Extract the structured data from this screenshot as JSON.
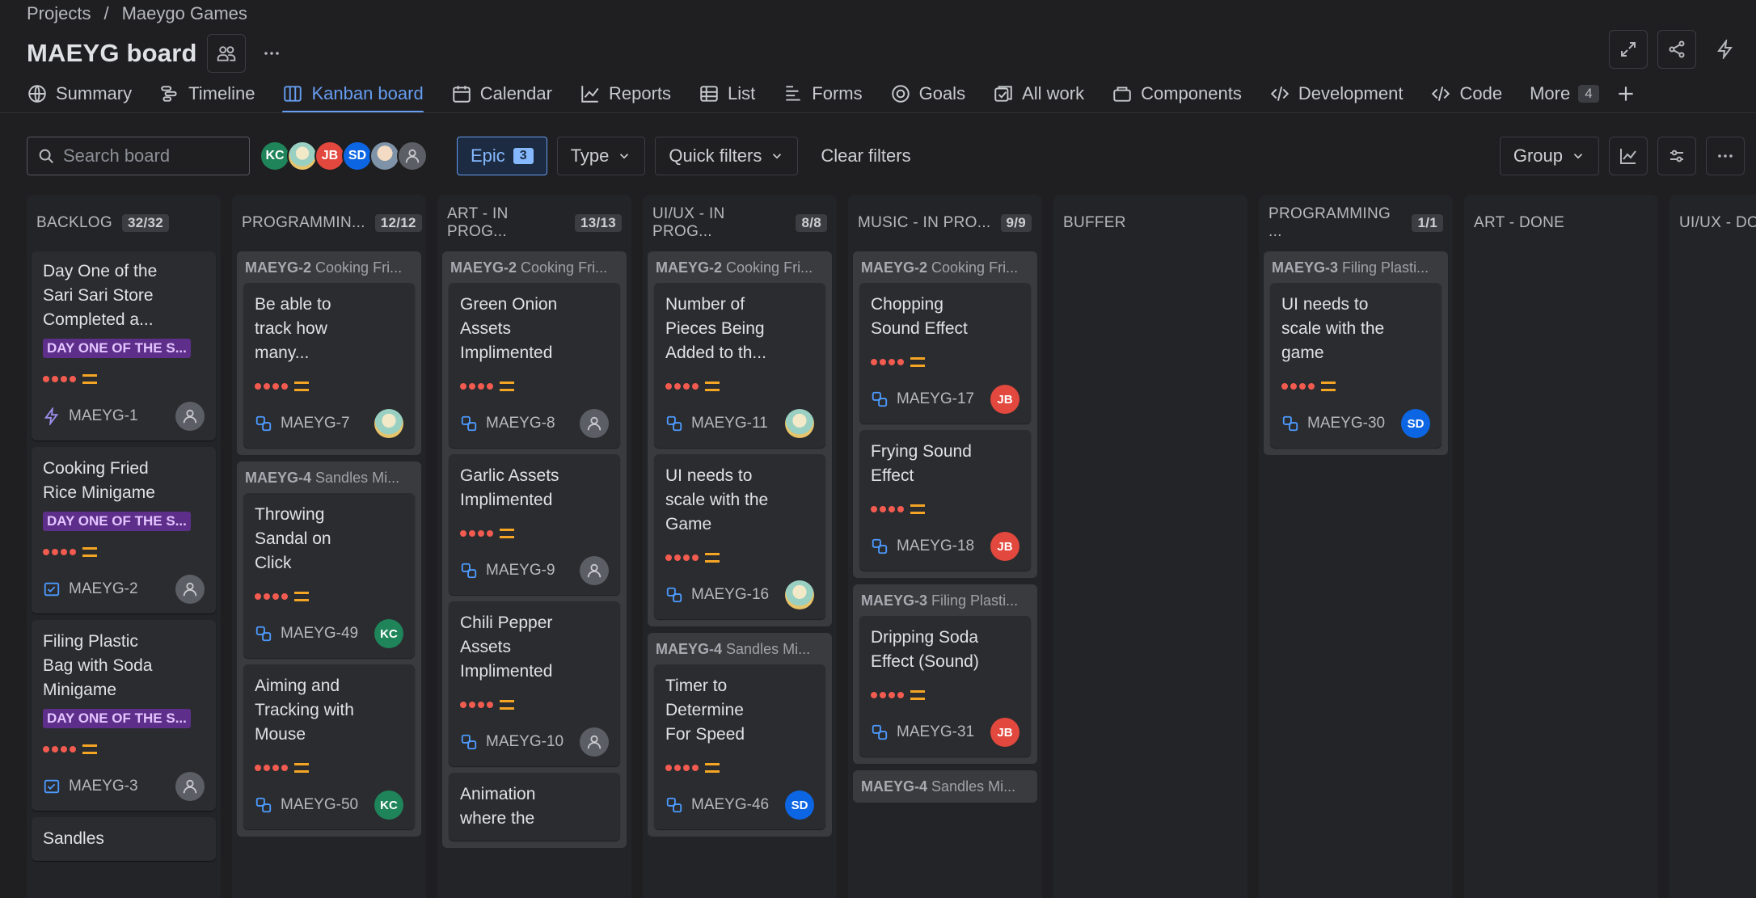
{
  "breadcrumb": {
    "projects": "Projects",
    "sep": "/",
    "project": "Maeygo Games"
  },
  "title": "MAEYG board",
  "tabs": [
    {
      "label": "Summary",
      "icon": "globe-icon"
    },
    {
      "label": "Timeline",
      "icon": "timeline-icon"
    },
    {
      "label": "Kanban board",
      "icon": "board-icon",
      "active": true
    },
    {
      "label": "Calendar",
      "icon": "calendar-icon"
    },
    {
      "label": "Reports",
      "icon": "reports-icon"
    },
    {
      "label": "List",
      "icon": "list-icon"
    },
    {
      "label": "Forms",
      "icon": "forms-icon"
    },
    {
      "label": "Goals",
      "icon": "goals-icon"
    },
    {
      "label": "All work",
      "icon": "all-work-icon"
    },
    {
      "label": "Components",
      "icon": "components-icon"
    },
    {
      "label": "Development",
      "icon": "development-icon"
    },
    {
      "label": "Code",
      "icon": "code-icon"
    }
  ],
  "more": {
    "label": "More",
    "count": "4"
  },
  "toolbar": {
    "search_placeholder": "Search board",
    "avatars": [
      "KC",
      "",
      "JB",
      "SD",
      "",
      ""
    ],
    "epic_label": "Epic",
    "epic_count": "3",
    "type_label": "Type",
    "quick_filters_label": "Quick filters",
    "clear_filters_label": "Clear filters",
    "group_label": "Group"
  },
  "colors": {
    "accent": "#669df1",
    "priority": "#f15b50",
    "epic": "#5e2f8a"
  },
  "columns": {
    "backlog": {
      "name": "BACKLOG",
      "count": "32/32",
      "cards": [
        {
          "title": "Day One of the Sari Sari Store Completed a...",
          "epic": "DAY ONE OF THE S...",
          "key": "MAEYG-1",
          "type": "epic-icon"
        },
        {
          "title": "Cooking Fried Rice Minigame",
          "epic": "DAY ONE OF THE S...",
          "key": "MAEYG-2",
          "type": "task-icon"
        },
        {
          "title": "Filing Plastic Bag with Soda Minigame",
          "epic": "DAY ONE OF THE S...",
          "key": "MAEYG-3",
          "type": "task-icon"
        },
        {
          "title": "Sandles"
        }
      ]
    },
    "programming": {
      "name": "PROGRAMMIN...",
      "count": "12/12",
      "groups": [
        {
          "key": "MAEYG-2",
          "name": "Cooking Fri...",
          "cards": [
            {
              "title": "Be able to track how many...",
              "key": "MAEYG-7",
              "avatar": "img"
            }
          ]
        },
        {
          "key": "MAEYG-4",
          "name": "Sandles Mi...",
          "cards": [
            {
              "title": "Throwing Sandal on Click",
              "key": "MAEYG-49",
              "avatar": "KC"
            },
            {
              "title": "Aiming and Tracking with Mouse",
              "key": "MAEYG-50",
              "avatar": "KC"
            }
          ]
        }
      ]
    },
    "art": {
      "name": "ART - IN PROG...",
      "count": "13/13",
      "groups": [
        {
          "key": "MAEYG-2",
          "name": "Cooking Fri...",
          "cards": [
            {
              "title": "Green Onion Assets Implimented",
              "key": "MAEYG-8",
              "avatar": "gray"
            },
            {
              "title": "Garlic Assets Implimented",
              "key": "MAEYG-9",
              "avatar": "gray"
            },
            {
              "title": "Chili Pepper Assets Implimented",
              "key": "MAEYG-10",
              "avatar": "gray"
            },
            {
              "title": "Animation where the"
            }
          ]
        }
      ]
    },
    "uiux": {
      "name": "UI/UX - IN PROG...",
      "count": "8/8",
      "groups": [
        {
          "key": "MAEYG-2",
          "name": "Cooking Fri...",
          "cards": [
            {
              "title": "Number of Pieces Being Added to th...",
              "key": "MAEYG-11",
              "avatar": "img"
            },
            {
              "title": "UI needs to scale with the Game",
              "key": "MAEYG-16",
              "avatar": "img"
            }
          ]
        },
        {
          "key": "MAEYG-4",
          "name": "Sandles Mi...",
          "cards": [
            {
              "title": "Timer to Determine For Speed",
              "key": "MAEYG-46",
              "avatar": "SD"
            }
          ]
        }
      ]
    },
    "music": {
      "name": "MUSIC - IN PRO...",
      "count": "9/9",
      "groups": [
        {
          "key": "MAEYG-2",
          "name": "Cooking Fri...",
          "cards": [
            {
              "title": "Chopping Sound Effect",
              "key": "MAEYG-17",
              "avatar": "JB"
            },
            {
              "title": "Frying Sound Effect",
              "key": "MAEYG-18",
              "avatar": "JB"
            }
          ]
        },
        {
          "key": "MAEYG-3",
          "name": "Filing Plasti...",
          "cards": [
            {
              "title": "Dripping Soda Effect (Sound)",
              "key": "MAEYG-31",
              "avatar": "JB"
            }
          ]
        },
        {
          "key": "MAEYG-4",
          "name": "Sandles Mi...",
          "cards": []
        }
      ]
    },
    "buffer": {
      "name": "BUFFER"
    },
    "programming_done": {
      "name": "PROGRAMMING ...",
      "count": "1/1",
      "groups": [
        {
          "key": "MAEYG-3",
          "name": "Filing Plasti...",
          "cards": [
            {
              "title": "UI needs to scale with the game",
              "key": "MAEYG-30",
              "avatar": "SD"
            }
          ]
        }
      ]
    },
    "art_done": {
      "name": "ART - DONE"
    },
    "uiux_done": {
      "name": "UI/UX - DO"
    }
  }
}
